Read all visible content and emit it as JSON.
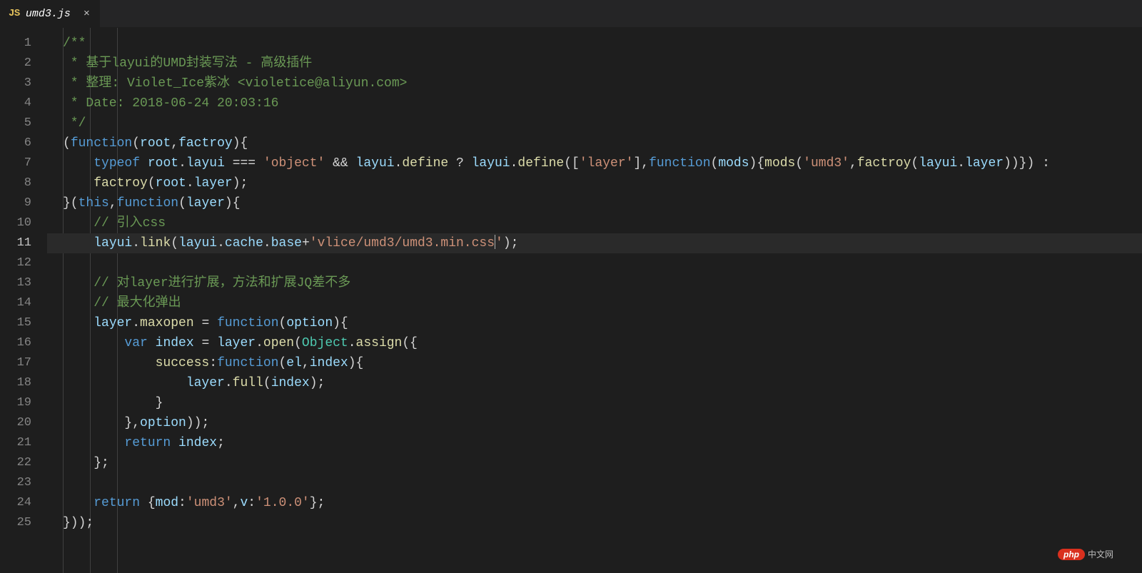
{
  "tab": {
    "icon_label": "JS",
    "filename": "umd3.js",
    "close_glyph": "×"
  },
  "current_line": 11,
  "lines": [
    [
      {
        "cls": "c-comment",
        "t": "/**"
      }
    ],
    [
      {
        "cls": "c-comment",
        "t": " * 基于layui的UMD封装写法 - 高级插件"
      }
    ],
    [
      {
        "cls": "c-comment",
        "t": " * 整理: Violet_Ice紫冰 <violetice@aliyun.com>"
      }
    ],
    [
      {
        "cls": "c-comment",
        "t": " * Date: 2018-06-24 20:03:16"
      }
    ],
    [
      {
        "cls": "c-comment",
        "t": " */"
      }
    ],
    [
      {
        "cls": "c-punc",
        "t": "("
      },
      {
        "cls": "c-key",
        "t": "function"
      },
      {
        "cls": "c-punc",
        "t": "("
      },
      {
        "cls": "c-var",
        "t": "root"
      },
      {
        "cls": "c-punc",
        "t": ","
      },
      {
        "cls": "c-var",
        "t": "factroy"
      },
      {
        "cls": "c-punc",
        "t": "){"
      }
    ],
    [
      {
        "cls": "c-punc",
        "t": "    "
      },
      {
        "cls": "c-key",
        "t": "typeof"
      },
      {
        "cls": "c-punc",
        "t": " "
      },
      {
        "cls": "c-var",
        "t": "root"
      },
      {
        "cls": "c-punc",
        "t": "."
      },
      {
        "cls": "c-var",
        "t": "layui"
      },
      {
        "cls": "c-punc",
        "t": " === "
      },
      {
        "cls": "c-str",
        "t": "'object'"
      },
      {
        "cls": "c-punc",
        "t": " && "
      },
      {
        "cls": "c-var",
        "t": "layui"
      },
      {
        "cls": "c-punc",
        "t": "."
      },
      {
        "cls": "c-func",
        "t": "define"
      },
      {
        "cls": "c-punc",
        "t": " ? "
      },
      {
        "cls": "c-var",
        "t": "layui"
      },
      {
        "cls": "c-punc",
        "t": "."
      },
      {
        "cls": "c-func",
        "t": "define"
      },
      {
        "cls": "c-punc",
        "t": "(["
      },
      {
        "cls": "c-str",
        "t": "'layer'"
      },
      {
        "cls": "c-punc",
        "t": "],"
      },
      {
        "cls": "c-key",
        "t": "function"
      },
      {
        "cls": "c-punc",
        "t": "("
      },
      {
        "cls": "c-var",
        "t": "mods"
      },
      {
        "cls": "c-punc",
        "t": "){"
      },
      {
        "cls": "c-func",
        "t": "mods"
      },
      {
        "cls": "c-punc",
        "t": "("
      },
      {
        "cls": "c-str",
        "t": "'umd3'"
      },
      {
        "cls": "c-punc",
        "t": ","
      },
      {
        "cls": "c-func",
        "t": "factroy"
      },
      {
        "cls": "c-punc",
        "t": "("
      },
      {
        "cls": "c-var",
        "t": "layui"
      },
      {
        "cls": "c-punc",
        "t": "."
      },
      {
        "cls": "c-var",
        "t": "layer"
      },
      {
        "cls": "c-punc",
        "t": "))}) :"
      }
    ],
    [
      {
        "cls": "c-punc",
        "t": "    "
      },
      {
        "cls": "c-func",
        "t": "factroy"
      },
      {
        "cls": "c-punc",
        "t": "("
      },
      {
        "cls": "c-var",
        "t": "root"
      },
      {
        "cls": "c-punc",
        "t": "."
      },
      {
        "cls": "c-var",
        "t": "layer"
      },
      {
        "cls": "c-punc",
        "t": ");"
      }
    ],
    [
      {
        "cls": "c-punc",
        "t": "}("
      },
      {
        "cls": "c-key",
        "t": "this"
      },
      {
        "cls": "c-punc",
        "t": ","
      },
      {
        "cls": "c-key",
        "t": "function"
      },
      {
        "cls": "c-punc",
        "t": "("
      },
      {
        "cls": "c-var",
        "t": "layer"
      },
      {
        "cls": "c-punc",
        "t": "){"
      }
    ],
    [
      {
        "cls": "c-punc",
        "t": "    "
      },
      {
        "cls": "c-comment",
        "t": "// 引入css"
      }
    ],
    [
      {
        "cls": "c-punc",
        "t": "    "
      },
      {
        "cls": "c-var",
        "t": "layui"
      },
      {
        "cls": "c-punc",
        "t": "."
      },
      {
        "cls": "c-func",
        "t": "link"
      },
      {
        "cls": "c-punc",
        "t": "("
      },
      {
        "cls": "c-var",
        "t": "layui"
      },
      {
        "cls": "c-punc",
        "t": "."
      },
      {
        "cls": "c-var",
        "t": "cache"
      },
      {
        "cls": "c-punc",
        "t": "."
      },
      {
        "cls": "c-var",
        "t": "base"
      },
      {
        "cls": "c-punc",
        "t": "+"
      },
      {
        "cls": "c-str",
        "t": "'vlice/umd3/umd3.min.css"
      },
      {
        "cls": "cursor",
        "t": ""
      },
      {
        "cls": "c-str",
        "t": "'"
      },
      {
        "cls": "c-punc",
        "t": ");"
      }
    ],
    [],
    [
      {
        "cls": "c-punc",
        "t": "    "
      },
      {
        "cls": "c-comment",
        "t": "// 对layer进行扩展，方法和扩展JQ差不多"
      }
    ],
    [
      {
        "cls": "c-punc",
        "t": "    "
      },
      {
        "cls": "c-comment",
        "t": "// 最大化弹出"
      }
    ],
    [
      {
        "cls": "c-punc",
        "t": "    "
      },
      {
        "cls": "c-var",
        "t": "layer"
      },
      {
        "cls": "c-punc",
        "t": "."
      },
      {
        "cls": "c-func",
        "t": "maxopen"
      },
      {
        "cls": "c-punc",
        "t": " = "
      },
      {
        "cls": "c-key",
        "t": "function"
      },
      {
        "cls": "c-punc",
        "t": "("
      },
      {
        "cls": "c-var",
        "t": "option"
      },
      {
        "cls": "c-punc",
        "t": "){"
      }
    ],
    [
      {
        "cls": "c-punc",
        "t": "        "
      },
      {
        "cls": "c-key",
        "t": "var"
      },
      {
        "cls": "c-punc",
        "t": " "
      },
      {
        "cls": "c-var",
        "t": "index"
      },
      {
        "cls": "c-punc",
        "t": " = "
      },
      {
        "cls": "c-var",
        "t": "layer"
      },
      {
        "cls": "c-punc",
        "t": "."
      },
      {
        "cls": "c-func",
        "t": "open"
      },
      {
        "cls": "c-punc",
        "t": "("
      },
      {
        "cls": "c-obj",
        "t": "Object"
      },
      {
        "cls": "c-punc",
        "t": "."
      },
      {
        "cls": "c-func",
        "t": "assign"
      },
      {
        "cls": "c-punc",
        "t": "({"
      }
    ],
    [
      {
        "cls": "c-punc",
        "t": "            "
      },
      {
        "cls": "c-func",
        "t": "success"
      },
      {
        "cls": "c-punc",
        "t": ":"
      },
      {
        "cls": "c-key",
        "t": "function"
      },
      {
        "cls": "c-punc",
        "t": "("
      },
      {
        "cls": "c-var",
        "t": "el"
      },
      {
        "cls": "c-punc",
        "t": ","
      },
      {
        "cls": "c-var",
        "t": "index"
      },
      {
        "cls": "c-punc",
        "t": "){"
      }
    ],
    [
      {
        "cls": "c-punc",
        "t": "                "
      },
      {
        "cls": "c-var",
        "t": "layer"
      },
      {
        "cls": "c-punc",
        "t": "."
      },
      {
        "cls": "c-func",
        "t": "full"
      },
      {
        "cls": "c-punc",
        "t": "("
      },
      {
        "cls": "c-var",
        "t": "index"
      },
      {
        "cls": "c-punc",
        "t": ");"
      }
    ],
    [
      {
        "cls": "c-punc",
        "t": "            }"
      }
    ],
    [
      {
        "cls": "c-punc",
        "t": "        },"
      },
      {
        "cls": "c-var",
        "t": "option"
      },
      {
        "cls": "c-punc",
        "t": "));"
      }
    ],
    [
      {
        "cls": "c-punc",
        "t": "        "
      },
      {
        "cls": "c-key",
        "t": "return"
      },
      {
        "cls": "c-punc",
        "t": " "
      },
      {
        "cls": "c-var",
        "t": "index"
      },
      {
        "cls": "c-punc",
        "t": ";"
      }
    ],
    [
      {
        "cls": "c-punc",
        "t": "    };"
      }
    ],
    [],
    [
      {
        "cls": "c-punc",
        "t": "    "
      },
      {
        "cls": "c-key",
        "t": "return"
      },
      {
        "cls": "c-punc",
        "t": " {"
      },
      {
        "cls": "c-var",
        "t": "mod"
      },
      {
        "cls": "c-punc",
        "t": ":"
      },
      {
        "cls": "c-str",
        "t": "'umd3'"
      },
      {
        "cls": "c-punc",
        "t": ","
      },
      {
        "cls": "c-var",
        "t": "v"
      },
      {
        "cls": "c-punc",
        "t": ":"
      },
      {
        "cls": "c-str",
        "t": "'1.0.0'"
      },
      {
        "cls": "c-punc",
        "t": "};"
      }
    ],
    [
      {
        "cls": "c-punc",
        "t": "}));"
      }
    ]
  ],
  "watermark": {
    "logo": "php",
    "text": "中文网"
  }
}
